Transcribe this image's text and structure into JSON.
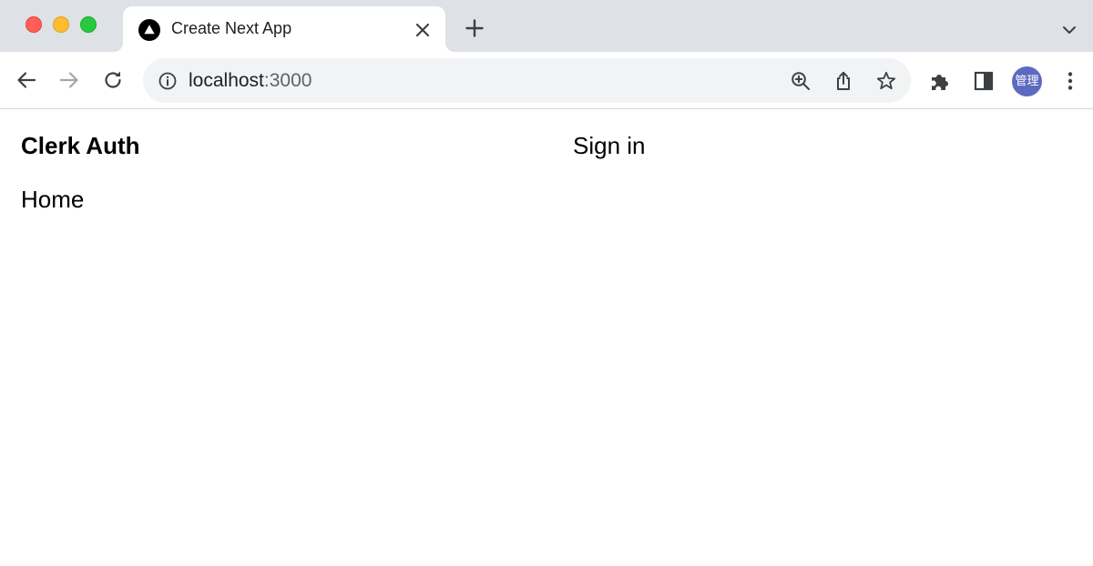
{
  "browser": {
    "tab": {
      "title": "Create Next App"
    },
    "address_bar": {
      "host": "localhost",
      "port": ":3000"
    },
    "profile": {
      "label": "管理",
      "color": "#5c6bc0"
    },
    "icons": {
      "tab_favicon": "nextjs-triangle-icon",
      "tab_close": "close-icon",
      "new_tab": "plus-icon",
      "tab_search": "chevron-down-icon",
      "back": "arrow-left-icon",
      "forward": "arrow-right-icon",
      "reload": "reload-icon",
      "site_info": "info-icon",
      "zoom": "zoom-in-icon",
      "share": "share-icon",
      "bookmark": "star-icon",
      "extensions": "puzzle-icon",
      "side_panel": "side-panel-icon",
      "menu": "kebab-menu-icon"
    }
  },
  "page": {
    "brand": "Clerk Auth",
    "sign_in": "Sign in",
    "home": "Home"
  }
}
